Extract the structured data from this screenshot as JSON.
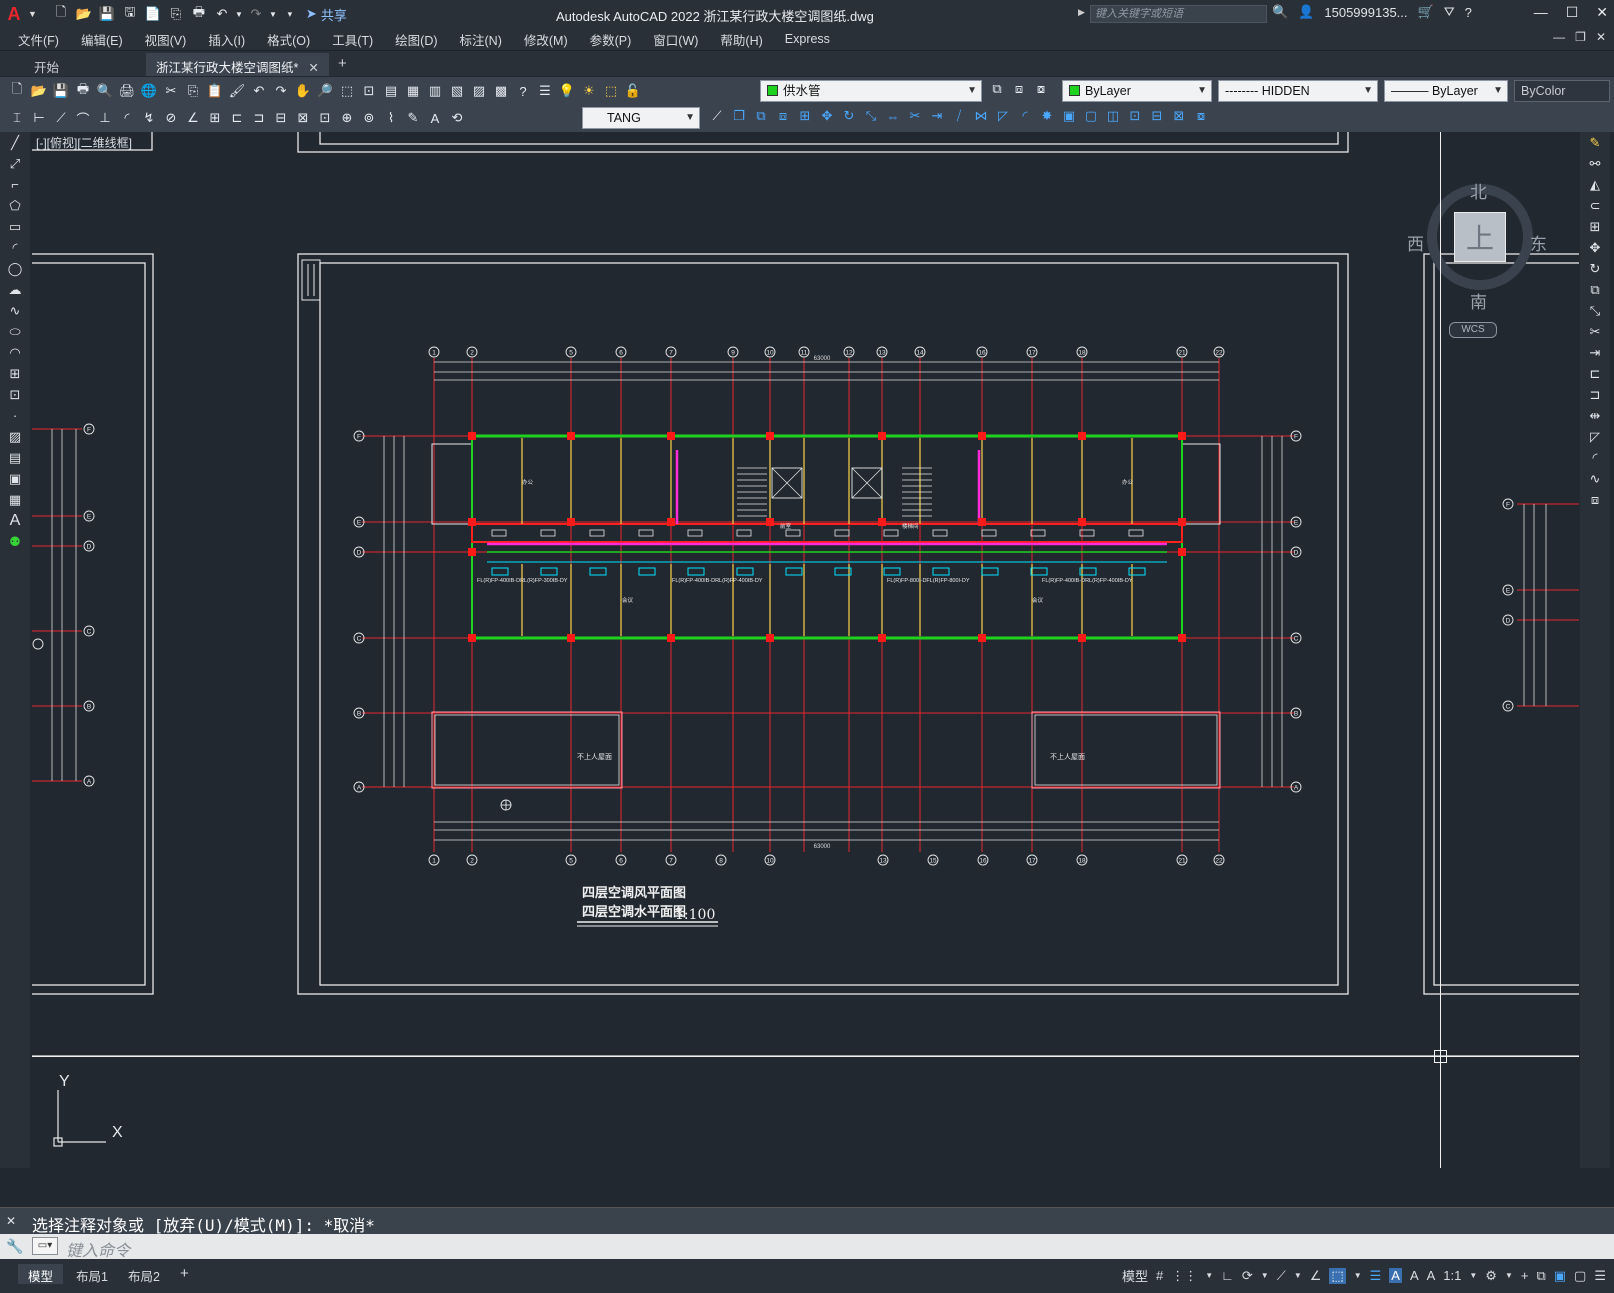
{
  "app": {
    "logo": "A",
    "title": "Autodesk AutoCAD 2022    浙江某行政大楼空调图纸.dwg",
    "share_label": "共享",
    "search_placeholder": "键入关键字或短语",
    "user": "1505999135...",
    "window_controls": [
      "minimize-icon",
      "maximize-icon",
      "close-icon"
    ]
  },
  "menu": [
    "文件(F)",
    "编辑(E)",
    "视图(V)",
    "插入(I)",
    "格式(O)",
    "工具(T)",
    "绘图(D)",
    "标注(N)",
    "修改(M)",
    "参数(P)",
    "窗口(W)",
    "帮助(H)",
    "Express"
  ],
  "tabs": [
    {
      "label": "开始",
      "active": false
    },
    {
      "label": "浙江某行政大楼空调图纸*",
      "active": true
    }
  ],
  "toolbar": {
    "layer": "供水管",
    "color": "ByLayer",
    "linetype": "-------- HIDDEN",
    "lineweight": "——— ByLayer",
    "plotstyle": "ByColor",
    "textstyle": "TANG"
  },
  "viewport": {
    "label": "[-][俯视][二维线框]",
    "viewcube": {
      "top": "上",
      "north": "北",
      "south": "南",
      "east": "东",
      "west": "西",
      "wcs": "WCS"
    },
    "ucs": {
      "x": "X",
      "y": "Y"
    }
  },
  "drawing": {
    "title_line1": "四层空调风平面图",
    "title_line2": "四层空调水平面图",
    "scale": "1:100",
    "axis_top": [
      "1",
      "2",
      "5",
      "6",
      "7",
      "9",
      "10",
      "11",
      "12",
      "13",
      "14",
      "16",
      "17",
      "18",
      "21",
      "22"
    ],
    "axis_bottom": [
      "1",
      "2",
      "5",
      "6",
      "7",
      "8",
      "10",
      "13",
      "15",
      "16",
      "17",
      "18",
      "21",
      "22"
    ],
    "axis_left": [
      "F",
      "E",
      "D",
      "C",
      "B",
      "A"
    ],
    "left_sheet_axis": [
      "F",
      "E",
      "D",
      "C",
      "B",
      "A"
    ],
    "right_sheet_axis": [
      "F",
      "E",
      "D",
      "C"
    ],
    "room_labels": [
      "不上人屋面",
      "不上人屋面",
      "前室",
      "楼梯间",
      "办公",
      "办公",
      "会议",
      "会议"
    ],
    "fcu_labels": [
      "FL(R)FP-400IB-DRL(R)FP-300IB-DY",
      "FL(R)FP-400IB-DRL(R)FP-400IB-DY",
      "FL(R)FP-800I-DFL(R)FP-800I-DY",
      "FL(R)FP-400IB-DRL(R)FP-400IB-DY"
    ],
    "dim_top_total": "63000",
    "dim_bottom_total": "63000"
  },
  "command": {
    "history": "选择注释对象或 [放弃(U)/模式(M)]: *取消*",
    "placeholder": "键入命令"
  },
  "status": {
    "layouts": [
      {
        "label": "模型",
        "active": true
      },
      {
        "label": "布局1",
        "active": false
      },
      {
        "label": "布局2",
        "active": false
      }
    ],
    "model_label": "模型",
    "annotation_scale": "1:1"
  }
}
